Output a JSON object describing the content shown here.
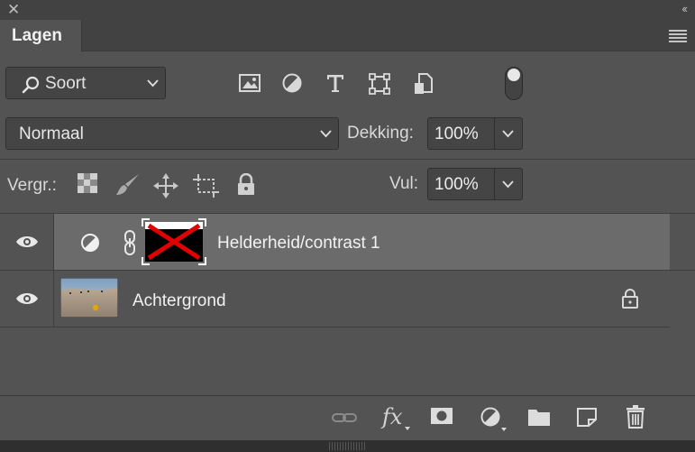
{
  "panel": {
    "close_glyph": "✕",
    "collapse_glyph": "‹‹",
    "tab_label": "Lagen"
  },
  "filter": {
    "kind_label": "Soort",
    "icons": [
      "image-filter-icon",
      "adjustment-filter-icon",
      "type-filter-icon",
      "shape-filter-icon",
      "smart-object-filter-icon"
    ],
    "filter_toggle_on": true
  },
  "blend": {
    "mode": "Normaal",
    "opacity_label": "Dekking:",
    "opacity_value": "100%"
  },
  "locks": {
    "label": "Vergr.:",
    "icons": [
      "lock-transparent-pixels-icon",
      "lock-image-pixels-icon",
      "lock-position-icon",
      "lock-artboard-icon",
      "lock-all-icon"
    ],
    "fill_label": "Vul:",
    "fill_value": "100%"
  },
  "layers": [
    {
      "name": "Helderheid/contrast 1",
      "type": "adjustment",
      "selected": true,
      "visible": true
    },
    {
      "name": "Achtergrond",
      "type": "background",
      "selected": false,
      "visible": true,
      "locked": true
    }
  ],
  "footer_icons": [
    "link-layers-icon",
    "fx-icon",
    "add-mask-icon",
    "new-adjustment-icon",
    "new-group-icon",
    "new-layer-icon",
    "delete-icon"
  ],
  "footer": {
    "fx_text": "fx"
  },
  "colors": {
    "panel_bg": "#535353",
    "selected_layer": "#6b6b6b",
    "mask_x": "#e00000"
  }
}
